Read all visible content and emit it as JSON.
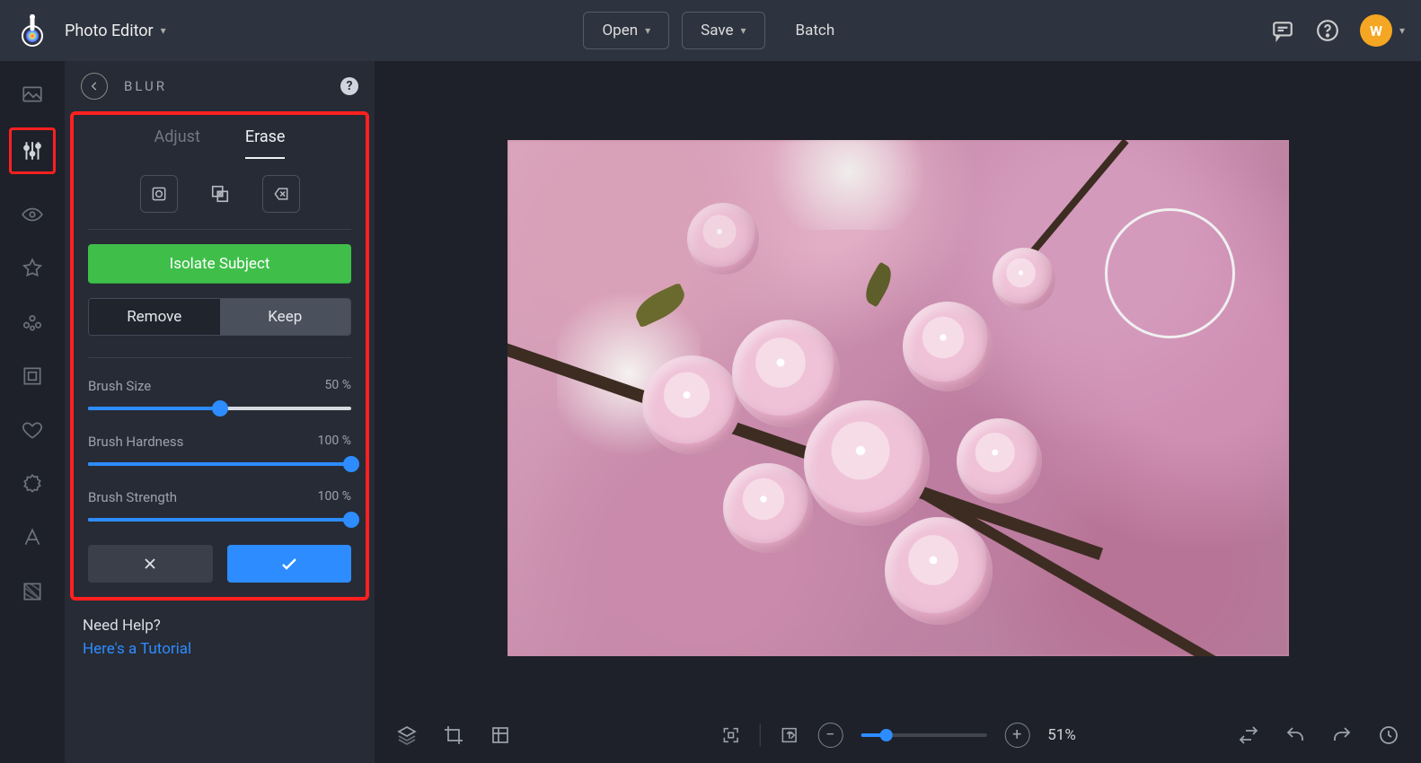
{
  "header": {
    "appTitle": "Photo Editor",
    "open": "Open",
    "save": "Save",
    "batch": "Batch",
    "avatarLetter": "W"
  },
  "panel": {
    "title": "BLUR",
    "tabs": {
      "adjust": "Adjust",
      "erase": "Erase"
    },
    "isolate": "Isolate Subject",
    "segment": {
      "remove": "Remove",
      "keep": "Keep"
    },
    "sliders": {
      "size": {
        "label": "Brush Size",
        "value": "50 %",
        "pct": 50
      },
      "hardness": {
        "label": "Brush Hardness",
        "value": "100 %",
        "pct": 100
      },
      "strength": {
        "label": "Brush Strength",
        "value": "100 %",
        "pct": 100
      }
    }
  },
  "help": {
    "question": "Need Help?",
    "link": "Here's a Tutorial"
  },
  "bottom": {
    "zoomLabel": "51%",
    "zoomPct": 20
  }
}
